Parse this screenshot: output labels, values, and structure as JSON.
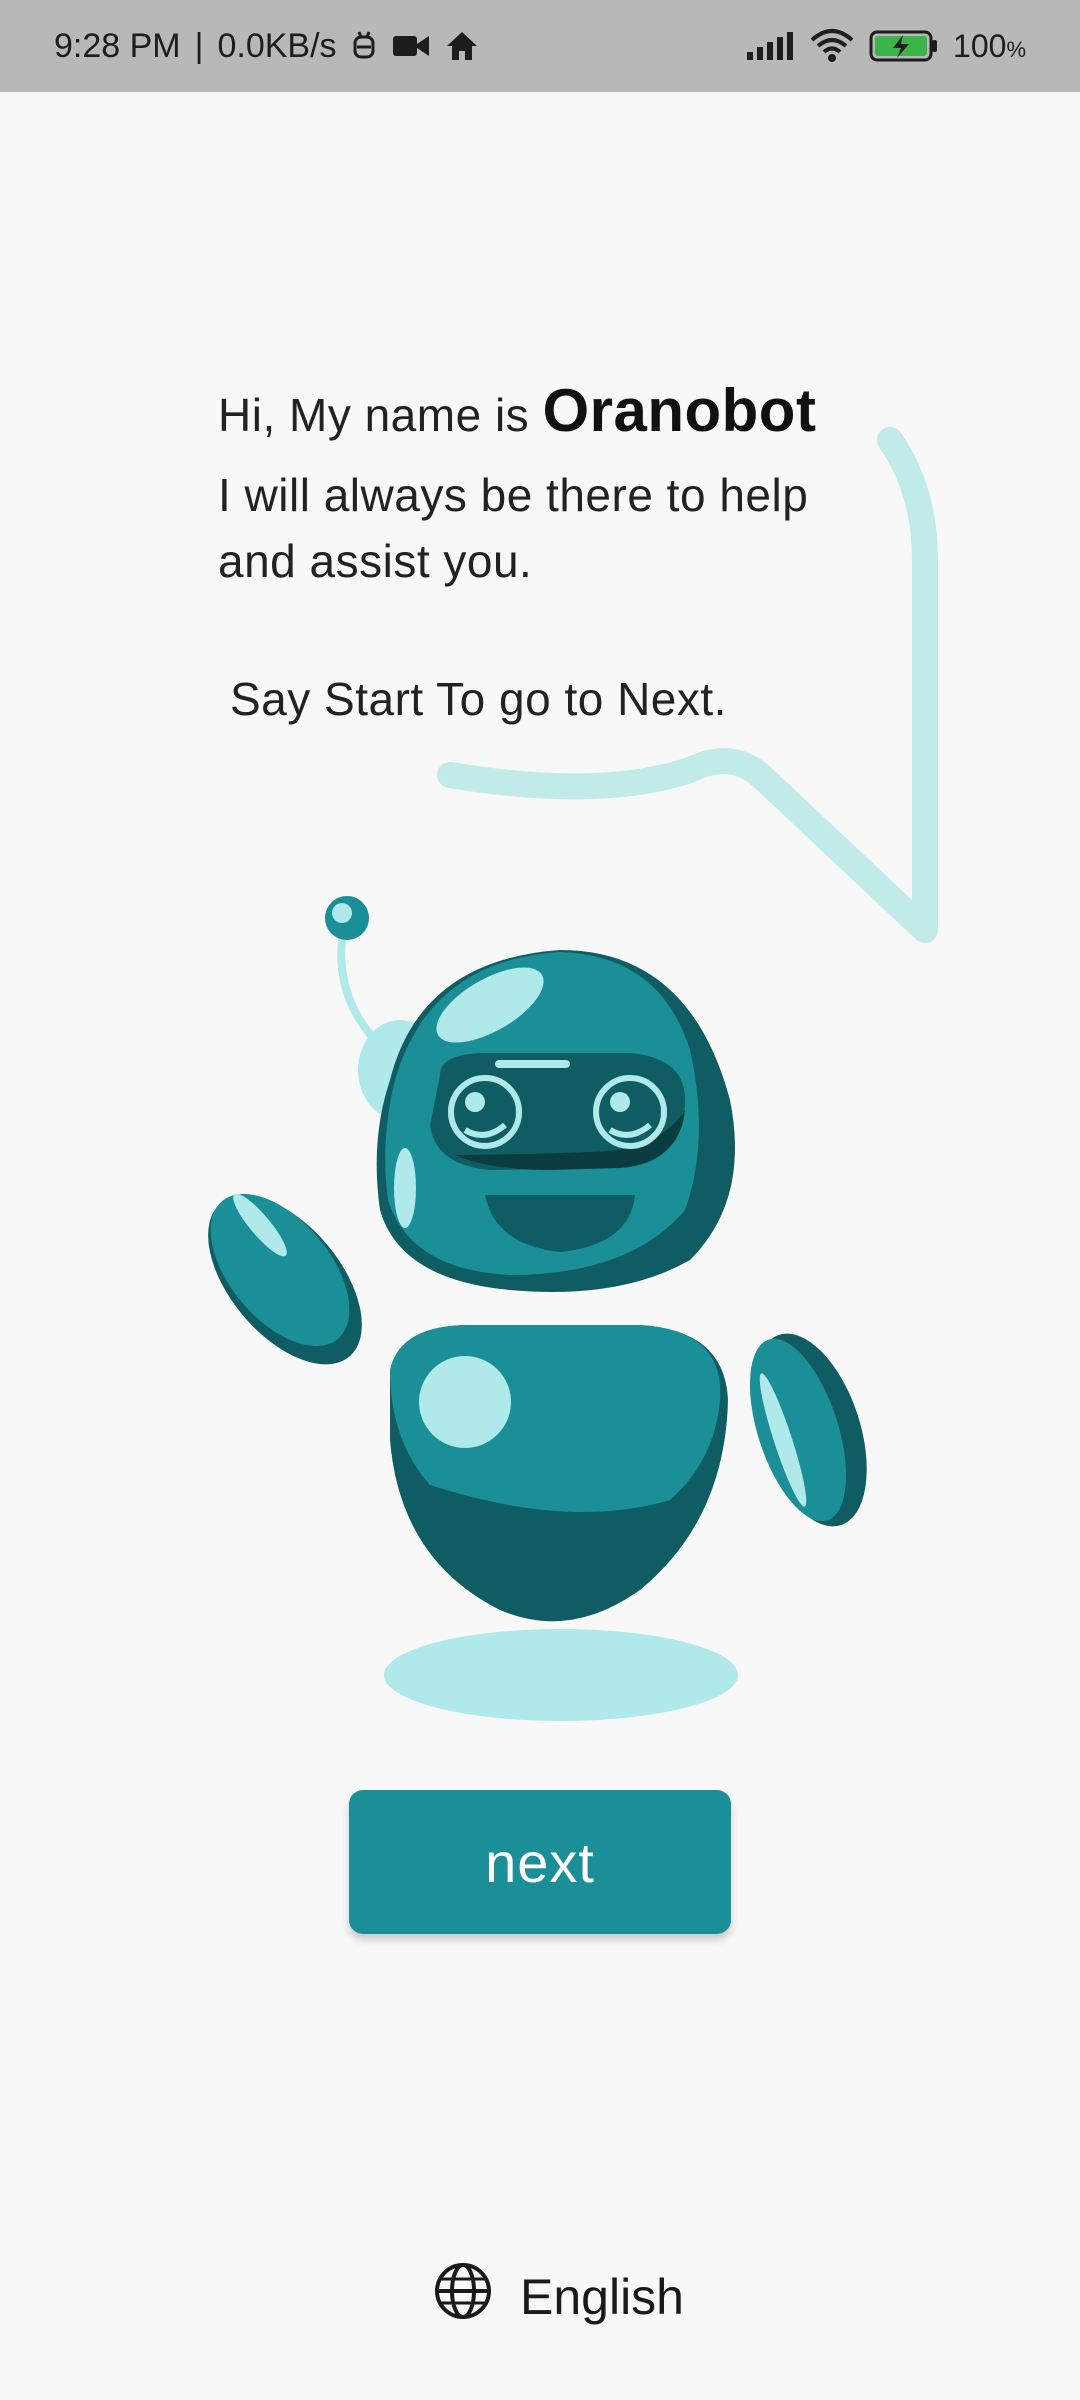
{
  "status_bar": {
    "time": "9:28 PM",
    "net_speed": "0.0KB/s",
    "battery": "100",
    "battery_unit": "%"
  },
  "speech": {
    "intro": "Hi, My name is",
    "bot_name": "Oranobot",
    "line2": "I will always be there to help",
    "line3": "and assist you.",
    "hint": "Say Start To go to Next."
  },
  "buttons": {
    "next_label": "next"
  },
  "language": {
    "label": "English",
    "icon": "globe-icon"
  },
  "colors": {
    "accent": "#1b8f98",
    "robot_dark": "#0f5d62",
    "robot_light": "#afe9ea",
    "status_bar": "#b8b8b8",
    "background": "#f8f8f8"
  }
}
